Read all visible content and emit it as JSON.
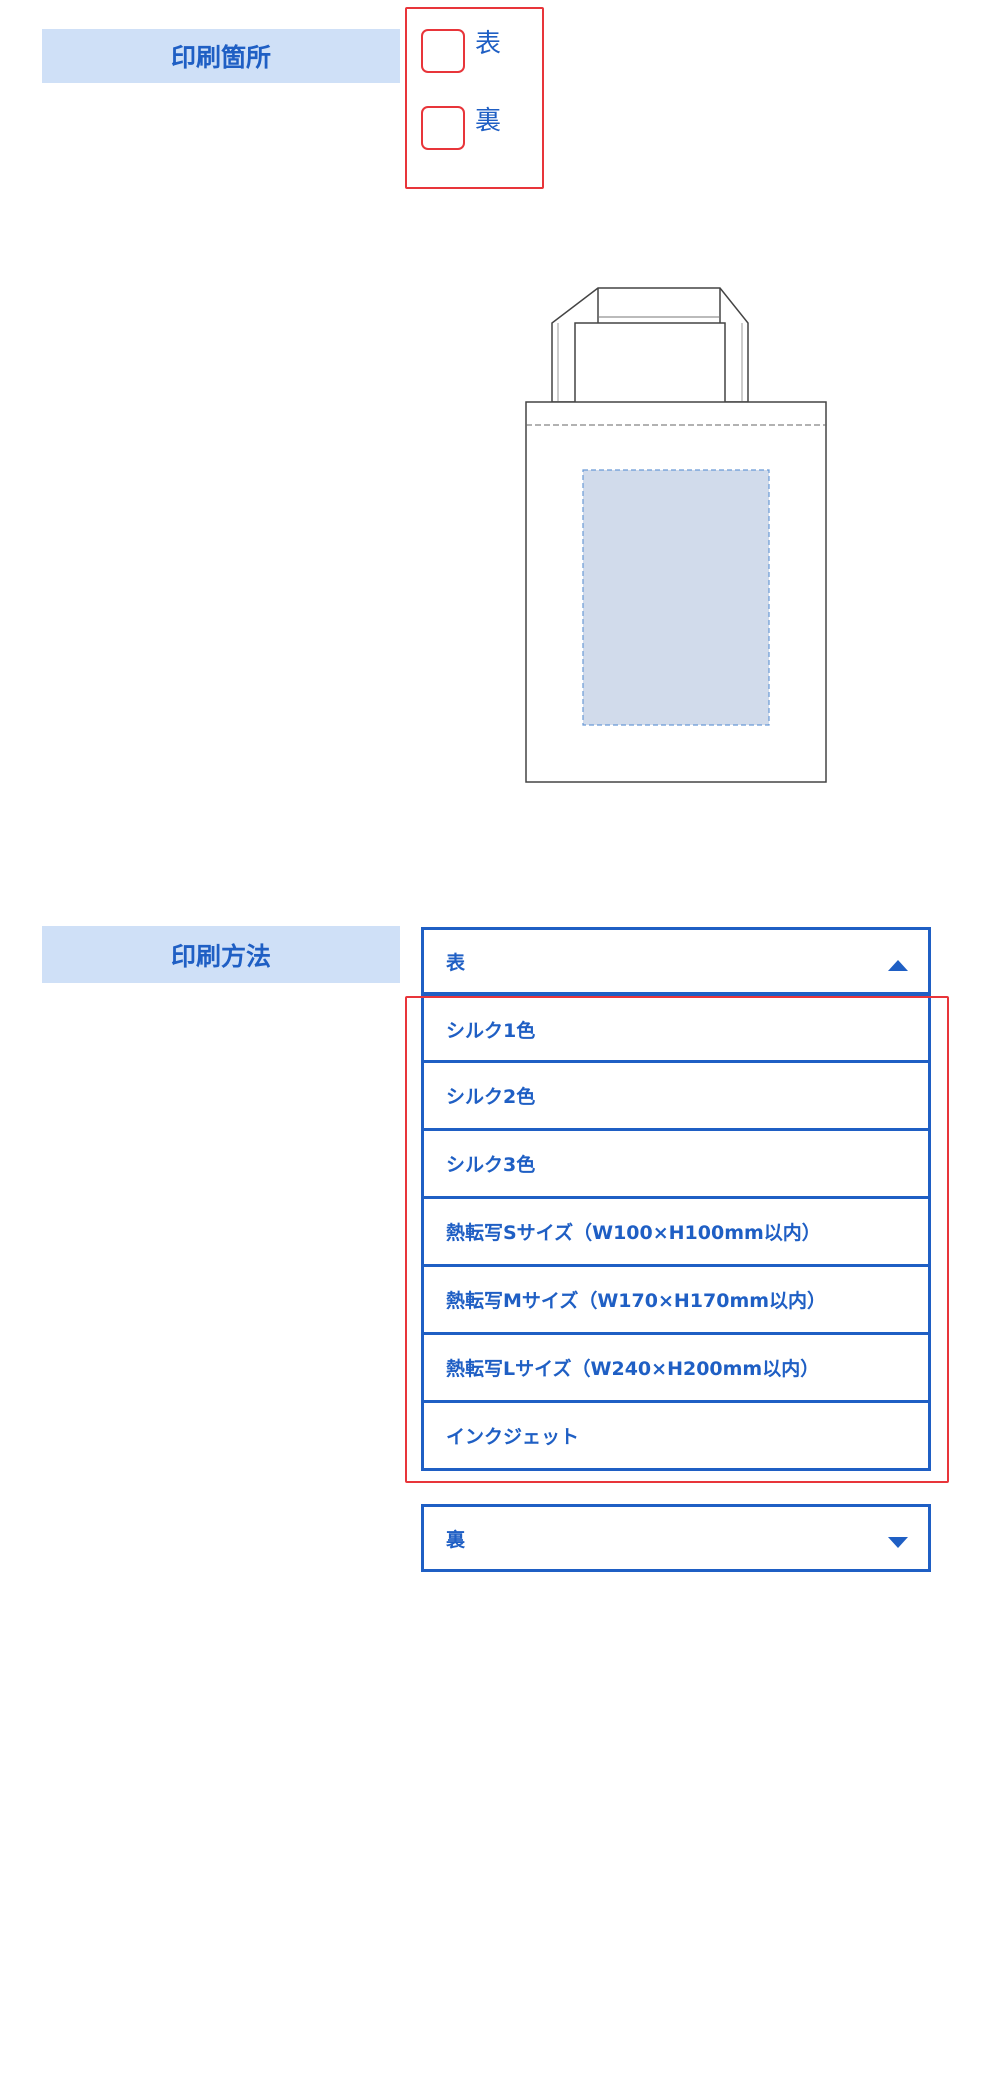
{
  "print_location": {
    "label": "印刷箇所",
    "options": [
      {
        "label": "表",
        "checked": false
      },
      {
        "label": "裏",
        "checked": false
      }
    ]
  },
  "print_method": {
    "label": "印刷方法",
    "front_select": {
      "value": "表",
      "expanded": true
    },
    "options": [
      "シルク1色",
      "シルク2色",
      "シルク3色",
      "熱転写Sサイズ（W100×H100mm以内）",
      "熱転写Mサイズ（W170×H170mm以内）",
      "熱転写Lサイズ（W240×H200mm以内）",
      "インクジェット"
    ],
    "back_select": {
      "value": "裏",
      "expanded": false
    }
  },
  "colors": {
    "accent": "#1f5fc4",
    "label_bg": "#cfe0f7",
    "highlight": "#e8353a",
    "print_area": "#d1dbeb"
  }
}
